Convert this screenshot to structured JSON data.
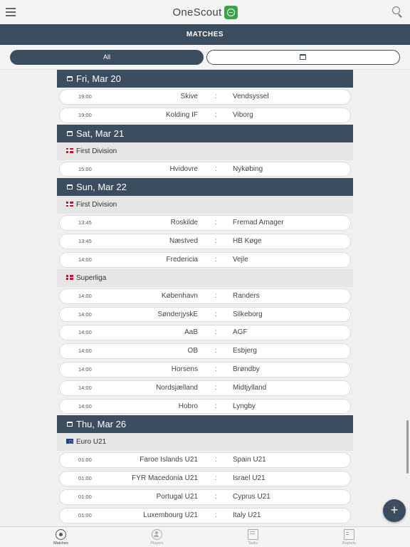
{
  "app": {
    "title": "OneScout"
  },
  "header": {
    "title": "MATCHES"
  },
  "filters": {
    "all_label": "All"
  },
  "days": [
    {
      "label": "Fri, Mar 20",
      "groups": [
        {
          "league": "",
          "flag": "",
          "matches": [
            {
              "time": "19:00",
              "home": "Skive",
              "away": "Vendsyssel"
            },
            {
              "time": "19:00",
              "home": "Kolding IF",
              "away": "Viborg"
            }
          ]
        }
      ]
    },
    {
      "label": "Sat, Mar 21",
      "groups": [
        {
          "league": "First Division",
          "flag": "dk",
          "matches": [
            {
              "time": "15:00",
              "home": "Hvidovre",
              "away": "Nykøbing"
            }
          ]
        }
      ]
    },
    {
      "label": "Sun, Mar 22",
      "groups": [
        {
          "league": "First Division",
          "flag": "dk",
          "matches": [
            {
              "time": "13:45",
              "home": "Roskilde",
              "away": "Fremad Amager"
            },
            {
              "time": "13:45",
              "home": "Næstved",
              "away": "HB Køge"
            },
            {
              "time": "14:00",
              "home": "Fredericia",
              "away": "Vejle"
            }
          ]
        },
        {
          "league": "Superliga",
          "flag": "dk",
          "matches": [
            {
              "time": "14:00",
              "home": "København",
              "away": "Randers"
            },
            {
              "time": "14:00",
              "home": "SønderjyskE",
              "away": "Silkeborg"
            },
            {
              "time": "14:00",
              "home": "AaB",
              "away": "AGF"
            },
            {
              "time": "14:00",
              "home": "OB",
              "away": "Esbjerg"
            },
            {
              "time": "14:00",
              "home": "Horsens",
              "away": "Brøndby"
            },
            {
              "time": "14:00",
              "home": "Nordsjælland",
              "away": "Midtjylland"
            },
            {
              "time": "14:00",
              "home": "Hobro",
              "away": "Lyngby"
            }
          ]
        }
      ]
    },
    {
      "label": "Thu, Mar 26",
      "groups": [
        {
          "league": "Euro U21",
          "flag": "eu",
          "matches": [
            {
              "time": "01:00",
              "home": "Faroe Islands U21",
              "away": "Spain U21"
            },
            {
              "time": "01:00",
              "home": "FYR Macedonia U21",
              "away": "Israel U21"
            },
            {
              "time": "01:00",
              "home": "Portugal U21",
              "away": "Cyprus U21"
            },
            {
              "time": "01:00",
              "home": "Luxembourg U21",
              "away": "Italy U21"
            }
          ]
        }
      ]
    }
  ],
  "fab": {
    "label": "+"
  },
  "tabs": [
    {
      "label": "Matches",
      "icon": "soccer-ball-icon",
      "active": true
    },
    {
      "label": "Players",
      "icon": "players-icon",
      "active": false
    },
    {
      "label": "Tasks",
      "icon": "tasks-icon",
      "active": false
    },
    {
      "label": "Reports",
      "icon": "reports-icon",
      "active": false
    }
  ],
  "colors": {
    "primary": "#3d4d60",
    "logo": "#3aa24a",
    "background": "#f0f0f0"
  }
}
